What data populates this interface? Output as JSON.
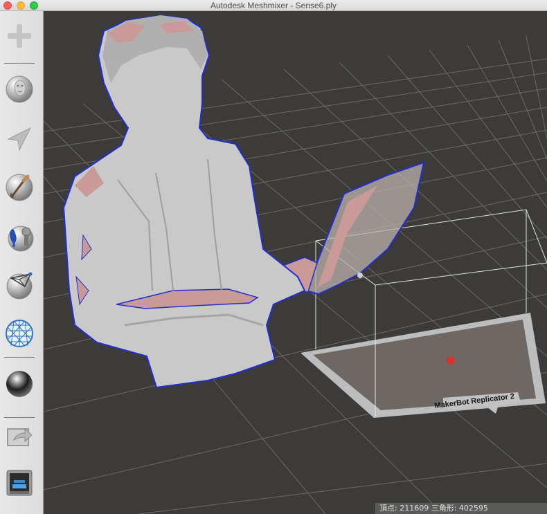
{
  "window": {
    "title": "Autodesk Meshmixer - Sense6.ply"
  },
  "toolbar": {
    "tools": [
      {
        "name": "import-tool",
        "icon": "plus-icon"
      },
      {
        "name": "meshmix-tool",
        "icon": "face-sphere-icon"
      },
      {
        "name": "select-tool",
        "icon": "arrow-pointer-icon"
      },
      {
        "name": "sculpt-tool",
        "icon": "brush-sphere-icon"
      },
      {
        "name": "stamp-tool",
        "icon": "stamp-sphere-icon"
      },
      {
        "name": "edit-tool",
        "icon": "mesh-edit-icon"
      },
      {
        "name": "analysis-tool",
        "icon": "mesh-ball-icon"
      },
      {
        "name": "shaders-tool",
        "icon": "chrome-ball-icon"
      },
      {
        "name": "export-tool",
        "icon": "export-icon"
      },
      {
        "name": "print-tool",
        "icon": "printer-icon"
      }
    ]
  },
  "viewport": {
    "printer_label": "MakerBot Replicator 2",
    "colors": {
      "background": "#3c3b39",
      "mesh": "#c9c9c9",
      "boundary": "#1f2fd0",
      "hole": "#c99a98"
    }
  },
  "status": {
    "text": "頂点: 211609 三角形: 402595"
  }
}
